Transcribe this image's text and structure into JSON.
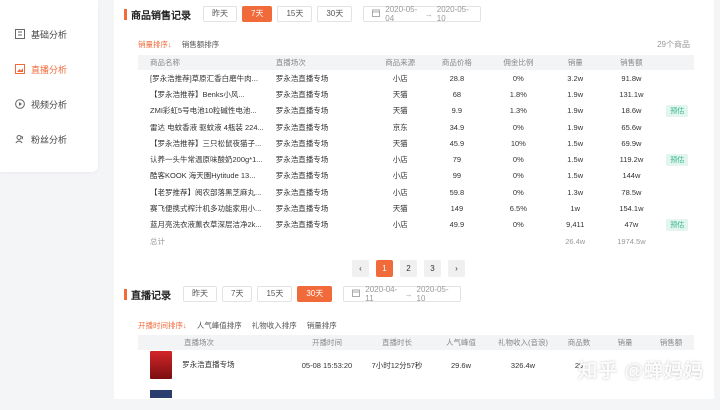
{
  "sidebar": {
    "items": [
      {
        "label": "基础分析",
        "icon": "grid-icon"
      },
      {
        "label": "直播分析",
        "icon": "image-icon"
      },
      {
        "label": "视频分析",
        "icon": "play-icon"
      },
      {
        "label": "粉丝分析",
        "icon": "users-icon"
      }
    ],
    "active": 1
  },
  "sales": {
    "title": "商品销售记录",
    "ranges": [
      "昨天",
      "7天",
      "15天",
      "30天"
    ],
    "active_range": "7天",
    "date_from": "2020-05-04",
    "date_to": "2020-05-10",
    "date_sep": "→",
    "sorts": [
      "销量排序↓",
      "销售额排序"
    ],
    "count": "29个商品",
    "headers": [
      "商品名称",
      "直播场次",
      "商品来源",
      "商品价格",
      "佣金比例",
      "销量",
      "销售额",
      ""
    ],
    "rows": [
      [
        "[罗永浩推荐]草原汇香白磨牛肉...",
        "罗永浩直播专场",
        "小店",
        "28.8",
        "0%",
        "3.2w",
        "91.8w",
        ""
      ],
      [
        "【罗永浩推荐】Benks小风...",
        "罗永浩直播专场",
        "天猫",
        "68",
        "1.8%",
        "1.9w",
        "131.1w",
        ""
      ],
      [
        "ZMI彩虹5号电池10粒碱性电池...",
        "罗永浩直播专场",
        "天猫",
        "9.9",
        "1.3%",
        "1.9w",
        "18.6w",
        "预估"
      ],
      [
        "雷达 电蚊香液 驱蚊液 4瓶装 224...",
        "罗永浩直播专场",
        "京东",
        "34.9",
        "0%",
        "1.9w",
        "65.6w",
        ""
      ],
      [
        "【罗永浩推荐】三只松鼠夜猫子...",
        "罗永浩直播专场",
        "天猫",
        "45.9",
        "10%",
        "1.5w",
        "69.9w",
        ""
      ],
      [
        "认养一头牛常温原味酸奶200g*1...",
        "罗永浩直播专场",
        "小店",
        "79",
        "0%",
        "1.5w",
        "119.2w",
        "预估"
      ],
      [
        "酷客KOOK 海天園Hytitude 13...",
        "罗永浩直播专场",
        "小店",
        "99",
        "0%",
        "1.5w",
        "144w",
        ""
      ],
      [
        "【老罗推荐】阅农部落黑芝麻丸...",
        "罗永浩直播专场",
        "小店",
        "59.8",
        "0%",
        "1.3w",
        "78.5w",
        ""
      ],
      [
        "赛飞便携式榨汁机多功能家用小...",
        "罗永浩直播专场",
        "天猫",
        "149",
        "6.5%",
        "1w",
        "154.1w",
        ""
      ],
      [
        "蓝月亮洗衣液薰衣草深层洁净2k...",
        "罗永浩直播专场",
        "小店",
        "49.9",
        "0%",
        "9,411",
        "47w",
        "预估"
      ]
    ],
    "total_label": "总计",
    "total_sales": "26.4w",
    "total_amount": "1974.5w",
    "pages": [
      "1",
      "2",
      "3"
    ],
    "active_page": "1",
    "prev": "‹",
    "next": "›"
  },
  "live": {
    "title": "直播记录",
    "ranges": [
      "昨天",
      "7天",
      "15天",
      "30天"
    ],
    "active_range": "30天",
    "date_from": "2020-04-11",
    "date_to": "2020-05-10",
    "date_sep": "→",
    "sorts": [
      "开播时间排序↓",
      "人气峰值排序",
      "礼物收入排序",
      "销量排序"
    ],
    "headers": [
      "直播场次",
      "开播时间",
      "直播时长",
      "人气峰值",
      "礼物收入(音浪)",
      "商品数",
      "销量",
      "销售额"
    ],
    "rows": [
      [
        "罗永浩直播专场",
        "05-08 15:53:20",
        "7小时12分57秒",
        "29.6w",
        "326.4w",
        "29",
        "",
        ""
      ]
    ]
  },
  "watermark": "知乎 @蝉妈妈",
  "colors": {
    "accent": "#f06a3a",
    "tag_bg": "#e2f5ef",
    "tag_text": "#35b58a"
  }
}
